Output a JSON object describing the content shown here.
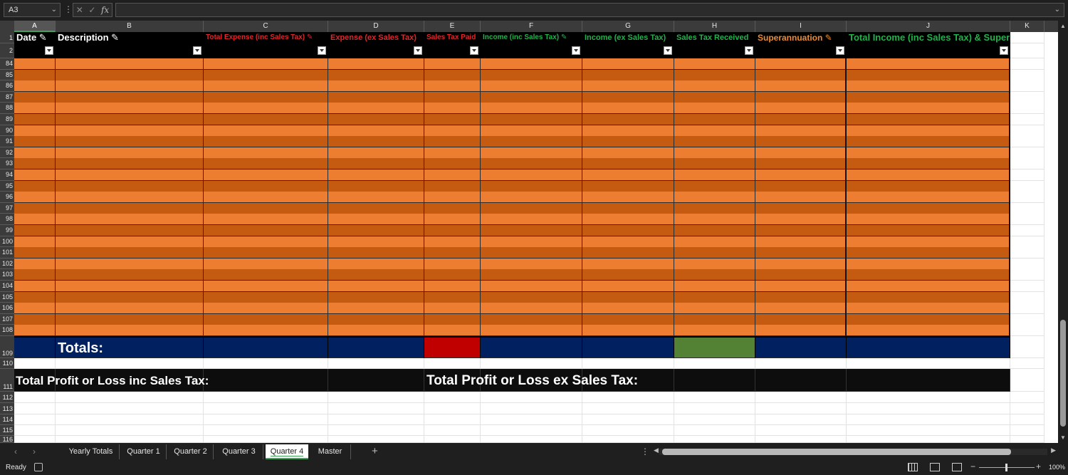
{
  "formula_bar": {
    "name_box": "A3",
    "fx": "fx",
    "formula": ""
  },
  "columns": [
    "A",
    "B",
    "C",
    "D",
    "E",
    "F",
    "G",
    "H",
    "I",
    "J",
    "K"
  ],
  "header_row_1": {
    "A": {
      "text": "Date ✎",
      "color": "#ffffff"
    },
    "B": {
      "text": "Description ✎",
      "color": "#ffffff"
    },
    "C": {
      "text": "Total Expense (inc Sales Tax) ✎",
      "color": "#e0262a"
    },
    "D": {
      "text": "Expense (ex Sales Tax)",
      "color": "#e0262a"
    },
    "E": {
      "text": "Sales Tax Paid",
      "color": "#e0262a"
    },
    "F": {
      "text": "Income (inc Sales Tax) ✎",
      "color": "#22b24c"
    },
    "G": {
      "text": "Income (ex Sales Tax)",
      "color": "#22b24c"
    },
    "H": {
      "text": "Sales Tax Received",
      "color": "#22b24c"
    },
    "I": {
      "text": "Superannuation ✎",
      "color": "#f08a2c"
    },
    "J": {
      "text": "Total Income (inc Sales Tax) & Super",
      "color": "#22b24c"
    }
  },
  "row_numbers": {
    "header": [
      "1",
      "2"
    ],
    "data": [
      "84",
      "85",
      "86",
      "87",
      "88",
      "89",
      "90",
      "91",
      "92",
      "93",
      "94",
      "95",
      "96",
      "97",
      "98",
      "99",
      "100",
      "101",
      "102",
      "103",
      "104",
      "105",
      "106",
      "107",
      "108"
    ],
    "tail": [
      "109",
      "110",
      "111",
      "112",
      "113",
      "114",
      "115",
      "116"
    ]
  },
  "totals_label": "Totals:",
  "profit_loss_inc_label": "Total Profit or Loss inc Sales Tax:",
  "profit_loss_ex_label": "Total Profit or Loss ex Sales Tax:",
  "colors": {
    "orange_light": "#ed7d31",
    "orange_dark": "#c55a11",
    "navy": "#002060",
    "red": "#c00000",
    "green": "#548235",
    "black": "#0d0d0d"
  },
  "sheet_tabs": [
    "Yearly Totals",
    "Quarter 1",
    "Quarter 2",
    "Quarter 3",
    "Quarter 4",
    "Master"
  ],
  "active_sheet": "Quarter 4",
  "status": {
    "ready": "Ready",
    "zoom": "100%"
  }
}
